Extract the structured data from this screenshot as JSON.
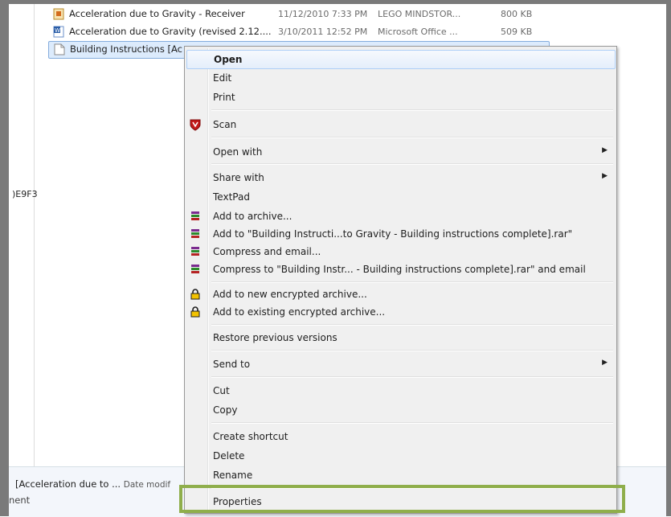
{
  "files": [
    {
      "name": "Acceleration due to Gravity - Receiver",
      "date": "11/12/2010 7:33 PM",
      "type": "LEGO MINDSTOR...",
      "size": "800 KB",
      "icon": "lego-file-icon"
    },
    {
      "name": "Acceleration due to Gravity (revised 2.12....",
      "date": "3/10/2011 12:52 PM",
      "type": "Microsoft Office ...",
      "size": "509 KB",
      "icon": "word-doc-icon"
    },
    {
      "name": "Building Instructions [Ac",
      "date": "",
      "type": "",
      "size": "",
      "icon": "blank-file-icon"
    }
  ],
  "left_pane": {
    "clipped_text": ")E9F3"
  },
  "details_pane": {
    "name": "[Acceleration due to ...",
    "date_label": "Date modif",
    "line2": "nent"
  },
  "menu": {
    "items": {
      "open": "Open",
      "edit": "Edit",
      "print": "Print",
      "scan": "Scan",
      "open_with": "Open with",
      "share_with": "Share with",
      "textpad": "TextPad",
      "add_archive": "Add to archive...",
      "add_rar": "Add to \"Building Instructi...to Gravity  - Building instructions complete].rar\"",
      "compress_email": "Compress and email...",
      "compress_rar_email": "Compress to \"Building Instr...  - Building instructions complete].rar\" and email",
      "add_encrypted": "Add to new encrypted archive...",
      "add_existing_encrypted": "Add to existing encrypted archive...",
      "restore": "Restore previous versions",
      "send_to": "Send to",
      "cut": "Cut",
      "copy": "Copy",
      "create_shortcut": "Create shortcut",
      "delete": "Delete",
      "rename": "Rename",
      "properties": "Properties"
    },
    "submenu_arrow": "▶"
  },
  "colors": {
    "highlight_box": "#8fae4b",
    "selection": "#dcebfc",
    "menu_bg": "#f0f0f0"
  }
}
